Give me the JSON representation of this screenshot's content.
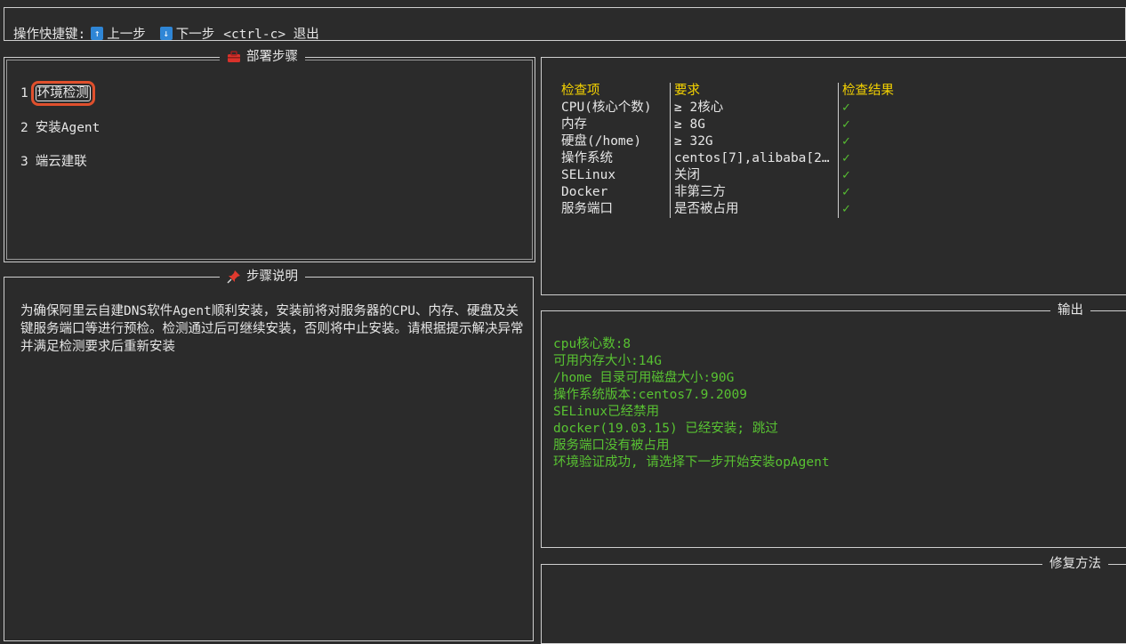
{
  "help_bar": {
    "label": "操作快捷键:",
    "up_key": "↑",
    "up_text": "上一步",
    "down_key": "↓",
    "down_text": "下一步",
    "exit_text": "<ctrl-c> 退出"
  },
  "steps_panel": {
    "title": "部署步骤",
    "icon": "toolbox-icon",
    "items": [
      {
        "num": "1",
        "label": "环境检测"
      },
      {
        "num": "2",
        "label": "安装Agent"
      },
      {
        "num": "3",
        "label": "端云建联"
      }
    ]
  },
  "desc_panel": {
    "title": "步骤说明",
    "icon": "pushpin-icon",
    "text": "为确保阿里云自建DNS软件Agent顺利安装，安装前将对服务器的CPU、内存、硬盘及关键服务端口等进行预检。检测通过后可继续安装，否则将中止安装。请根据提示解决异常并满足检测要求后重新安装"
  },
  "check_table": {
    "headers": [
      "检查项",
      "要求",
      "检查结果"
    ],
    "rows": [
      [
        "CPU(核心个数)",
        "≥ 2核心",
        "✓"
      ],
      [
        "内存",
        "≥ 8G",
        "✓"
      ],
      [
        "硬盘(/home)",
        "≥ 32G",
        "✓"
      ],
      [
        "操作系统",
        "centos[7],alibaba[2…",
        "✓"
      ],
      [
        "SELinux",
        "关闭",
        "✓"
      ],
      [
        "Docker",
        "非第三方",
        "✓"
      ],
      [
        "服务端口",
        "是否被占用",
        "✓"
      ]
    ]
  },
  "output_panel": {
    "title": "输出",
    "lines": [
      "cpu核心数:8",
      "可用内存大小:14G",
      "/home 目录可用磁盘大小:90G",
      "操作系统版本:centos7.9.2009",
      "SELinux已经禁用",
      "docker(19.03.15) 已经安装; 跳过",
      "服务端口没有被占用",
      "环境验证成功, 请选择下一步开始安装opAgent"
    ]
  },
  "fix_panel": {
    "title": "修复方法"
  },
  "colors": {
    "background": "#2b2b2b",
    "header_yellow": "#f5d300",
    "ok_green": "#58c232",
    "active_outline": "#e0502d",
    "keycap_blue": "#2f86d6"
  }
}
